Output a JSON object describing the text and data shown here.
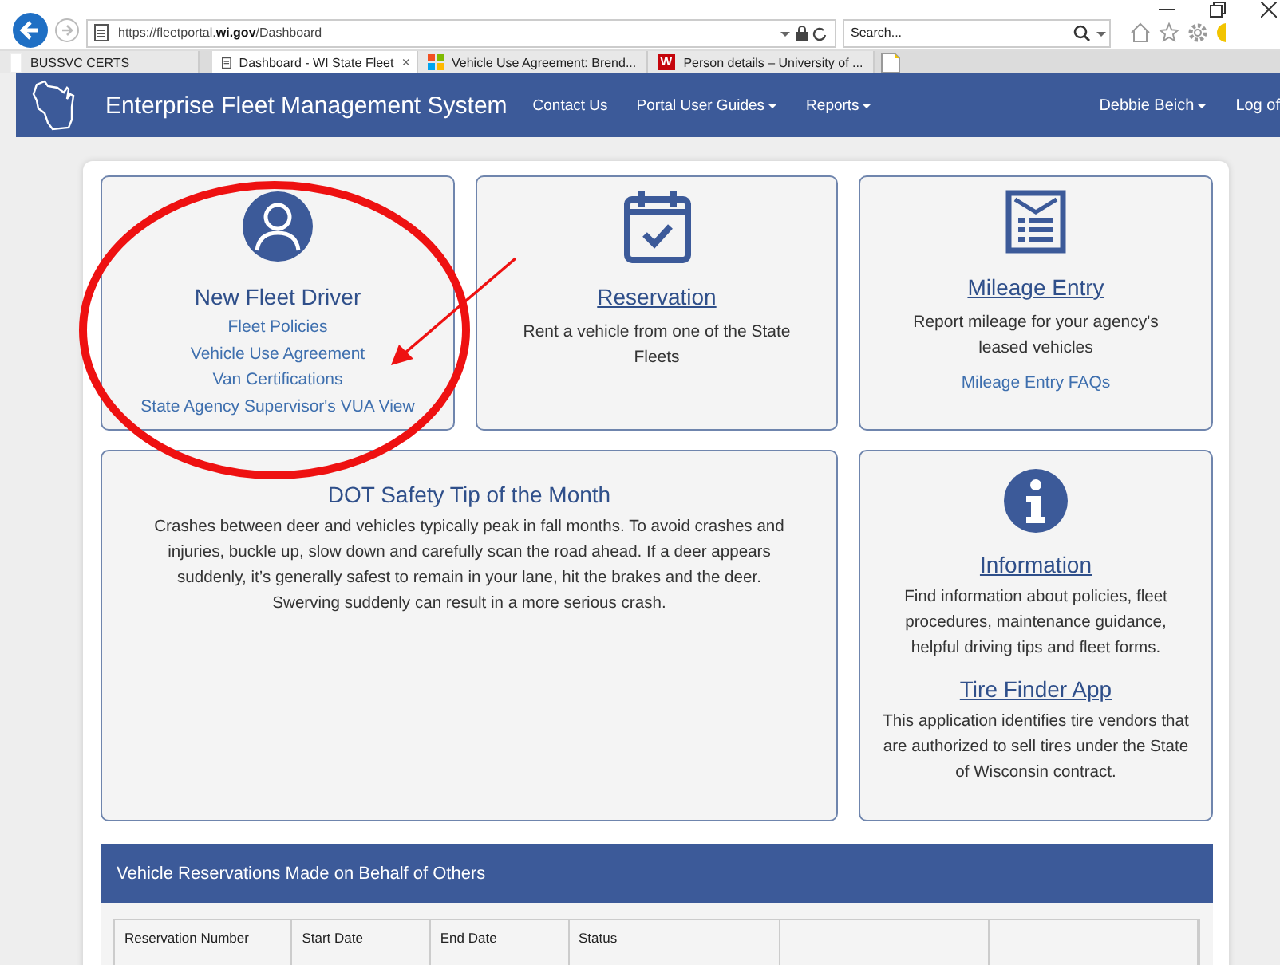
{
  "browser": {
    "url_prefix": "https://fleetportal.",
    "url_domain": "wi.gov",
    "url_path": "/Dashboard",
    "search": {
      "placeholder": "Search..."
    },
    "tabs": [
      {
        "label": "BUSSVC CERTS",
        "selected": false,
        "kind": "plain"
      },
      {
        "label": "Dashboard - WI State Fleet",
        "selected": true,
        "kind": "page",
        "close": "×"
      },
      {
        "label": "Vehicle Use Agreement: Brend...",
        "selected": false,
        "kind": "tiles"
      },
      {
        "label": "Person details – University of ...",
        "selected": false,
        "kind": "w",
        "badge": "W"
      }
    ]
  },
  "nav": {
    "title": "Enterprise Fleet Management System",
    "links": [
      {
        "label": "Contact Us",
        "dropdown": false
      },
      {
        "label": "Portal User Guides",
        "dropdown": true
      },
      {
        "label": "Reports",
        "dropdown": true
      }
    ],
    "user": {
      "label": "Debbie Beich",
      "dropdown": true
    },
    "logout": "Log of"
  },
  "cards": [
    {
      "kind": "links",
      "title": "New Fleet Driver",
      "links": [
        "Fleet Policies",
        "Vehicle Use Agreement",
        "Van Certifications",
        "State Agency Supervisor's VUA View"
      ]
    },
    {
      "kind": "link",
      "title": "Reservation",
      "text": "Rent a vehicle from one of the State Fleets"
    },
    {
      "kind": "link",
      "title": "Mileage Entry",
      "text": "Report mileage for your agency's leased vehicles",
      "links": [
        "Mileage Entry FAQs"
      ]
    }
  ],
  "tip": {
    "title": "DOT Safety Tip of the Month",
    "text": "Crashes between deer and vehicles typically peak in fall months. To avoid crashes and injuries, buckle up, slow down and carefully scan the road ahead. If a deer appears suddenly, it’s generally safest to remain in your lane, hit the brakes and the deer. Swerving suddenly can result in a more serious crash."
  },
  "info": {
    "sections": [
      {
        "title": "Information",
        "text": "Find information about policies, fleet procedures, maintenance guidance, helpful driving tips and fleet forms."
      },
      {
        "title": "Tire Finder App",
        "text": "This application identifies tire vendors that are authorized to sell tires under the State of Wisconsin contract."
      }
    ]
  },
  "reservations": {
    "title": "Vehicle Reservations Made on Behalf of Others",
    "columns": [
      "Reservation Number",
      "Start Date",
      "End Date",
      "Status"
    ]
  }
}
